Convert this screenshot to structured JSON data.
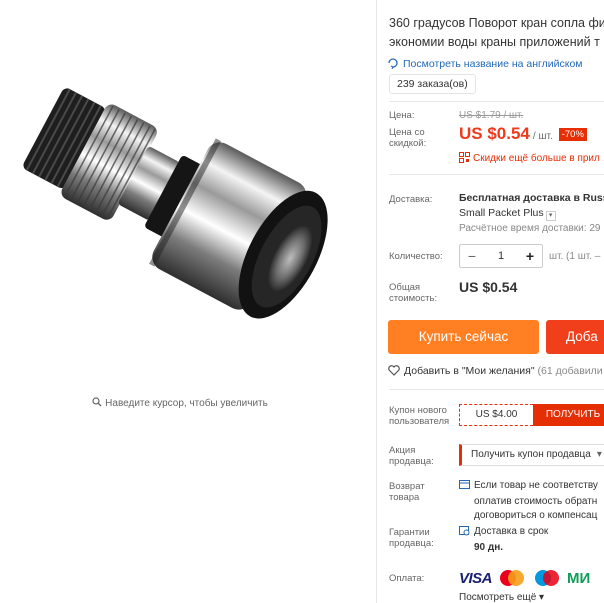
{
  "product": {
    "title_line1": "360 градусов Поворот кран сопла фи",
    "title_line2": "экономии воды краны приложений т",
    "translate_link": "Посмотреть название на английском",
    "orders": "239 заказа(ов)"
  },
  "gallery": {
    "zoom_hint": "Наведите курсор, чтобы увеличить"
  },
  "price": {
    "label": "Цена:",
    "old": "US $1.79 / шт.",
    "discount_label": "Цена со скидкой:",
    "new": "US $0.54",
    "unit": "/ шт.",
    "discount_badge": "-70%",
    "promo": "Скидки ещё больше в прил"
  },
  "shipping": {
    "label": "Доставка:",
    "method": "Бесплатная доставка в Russi",
    "service": "Small Packet Plus",
    "time": "Расчётное время доставки: 29"
  },
  "quantity": {
    "label": "Количество:",
    "minus": "−",
    "value": "1",
    "plus": "+",
    "note": "шт. (1 шт. –"
  },
  "total": {
    "label": "Общая стоимость:",
    "value": "US $0.54"
  },
  "actions": {
    "buy_now": "Купить сейчас",
    "add_to_cart": "Доба",
    "wishlist": "Добавить в \"Мои желания\"",
    "wishlist_count": "(61 добавили"
  },
  "coupon": {
    "label": "Купон нового пользователя",
    "amount": "US $4.00",
    "get": "ПОЛУЧИТЬ"
  },
  "seller_promo": {
    "label": "Акция продавца:",
    "select": "Получить купон продавца"
  },
  "returns": {
    "label": "Возврат товара",
    "text_line1": "Если товар не соответству",
    "text_line2": "оплатив стоимость обратн",
    "text_line3": "договориться о компенсац"
  },
  "guarantee": {
    "label": "Гарантии продавца:",
    "text": "Доставка в срок",
    "days": "90 дн."
  },
  "payment": {
    "label": "Оплата:",
    "visa": "VISA",
    "mir": "МИ",
    "more": "Посмотреть ещё"
  },
  "colors": {
    "accent_red": "#e62e04",
    "buy_orange": "#ff7f22",
    "link_blue": "#2469b7"
  }
}
